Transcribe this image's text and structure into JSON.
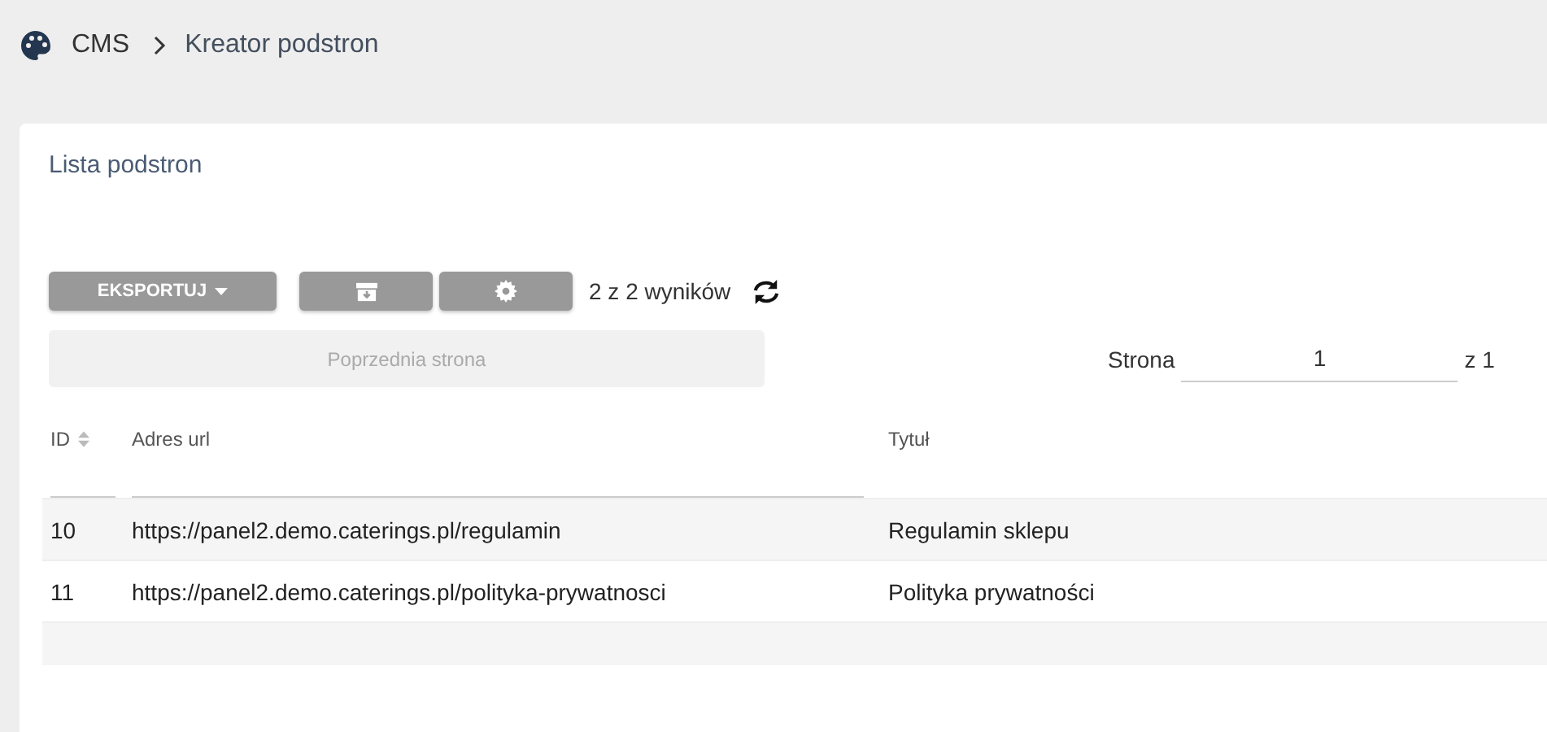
{
  "breadcrumb": [
    "CMS",
    "Kreator podstron"
  ],
  "card": {
    "title": "Lista podstron"
  },
  "toolbar": {
    "export_button": "EKSPORTUJ",
    "result_count": "2 z 2 wyników"
  },
  "pagination": {
    "previous_button": "Poprzednia strona",
    "previous_disabled": true,
    "page_label": "Strona",
    "page_value": "1",
    "page_total": "z 1"
  },
  "table": {
    "columns": [
      {
        "label": "ID",
        "kind": "sortable"
      },
      {
        "label": "Adres url",
        "kind": "plain"
      },
      {
        "label": "Tytuł",
        "kind": "plain"
      }
    ],
    "filters": [
      {
        "kind": "text"
      },
      {
        "kind": "text"
      },
      {
        "kind": "none"
      }
    ],
    "rows": [
      {
        "cells": [
          "10",
          "https://panel2.demo.caterings.pl/regulamin",
          "Regulamin sklepu"
        ]
      },
      {
        "cells": [
          "11",
          "https://panel2.demo.caterings.pl/polityka-prywatnosci",
          "Polityka prywatności"
        ]
      }
    ]
  }
}
